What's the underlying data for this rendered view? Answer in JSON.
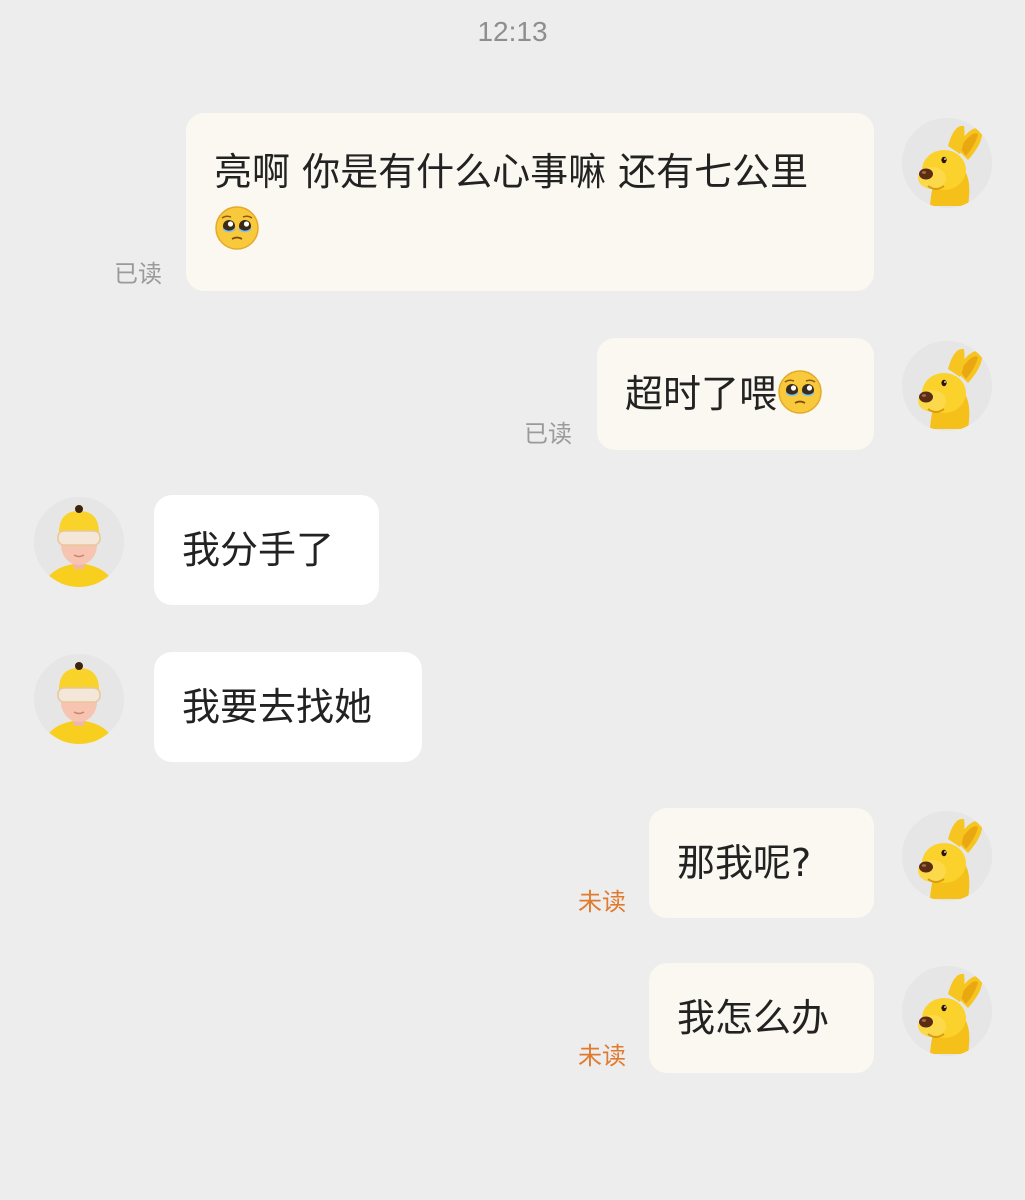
{
  "chat": {
    "timestamp": "12:13",
    "messages": [
      {
        "side": "right",
        "text": "亮啊 你是有什么心事嘛 还有七公里",
        "emoji": "pleading-face",
        "status": "已读"
      },
      {
        "side": "right",
        "text": "超时了喂",
        "emoji": "pleading-face",
        "status": "已读"
      },
      {
        "side": "left",
        "text": "我分手了"
      },
      {
        "side": "left",
        "text": "我要去找她"
      },
      {
        "side": "right",
        "text": "那我呢?",
        "status": "未读"
      },
      {
        "side": "right",
        "text": "我怎么办",
        "status": "未读"
      }
    ]
  },
  "icons": {
    "self_avatar": "yellow-dog-avatar",
    "peer_avatar": "courier-helmet-avatar",
    "emoji": "pleading-face-emoji"
  },
  "colors": {
    "background": "#ededed",
    "outgoing_bubble": "#fbf8f1",
    "incoming_bubble": "#ffffff",
    "read_status": "#9a9a9a",
    "unread_status": "#e07a2e",
    "avatar_yellow": "#f7c51f"
  }
}
